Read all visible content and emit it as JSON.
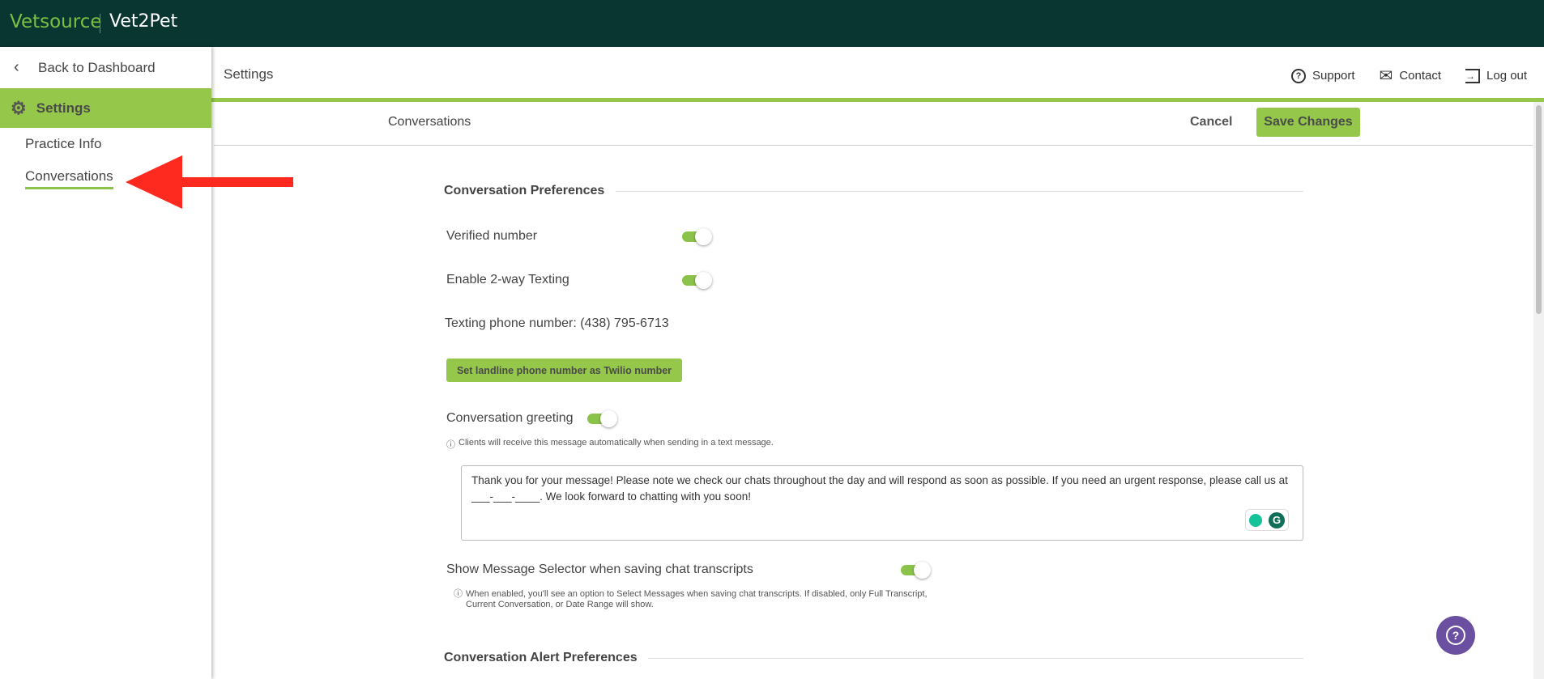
{
  "header": {
    "brand": "Vetsource",
    "app": "Vet2Pet"
  },
  "sidebar": {
    "back": "Back to Dashboard",
    "section": "Settings",
    "items": [
      {
        "label": "Practice Info"
      },
      {
        "label": "Conversations"
      }
    ]
  },
  "topbar": {
    "title": "Settings",
    "links": [
      {
        "label": "Support",
        "icon": "help-circle-icon"
      },
      {
        "label": "Contact",
        "icon": "mail-icon"
      },
      {
        "label": "Log out",
        "icon": "logout-icon"
      }
    ]
  },
  "subbar": {
    "title": "Conversations",
    "cancel": "Cancel",
    "save": "Save Changes"
  },
  "prefs": {
    "section_title": "Conversation Preferences",
    "verified_number": {
      "label": "Verified number",
      "on": true
    },
    "two_way": {
      "label": "Enable 2-way Texting",
      "on": true
    },
    "phone": "Texting phone number: (438) 795-6713",
    "landline_button": "Set landline phone number as Twilio number",
    "greeting": {
      "label": "Conversation greeting",
      "on": true,
      "info": "Clients will receive this message automatically when sending in a text message.",
      "text": "Thank you for your message! Please note we check our chats throughout the day and will respond as soon as possible. If you need an urgent response, please call us at ___-___-____. We look forward to chatting with you soon!"
    },
    "selector": {
      "label": "Show Message Selector when saving chat transcripts",
      "on": true,
      "info": "When enabled, you'll see an option to Select Messages when saving chat transcripts. If disabled, only Full Transcript, Current Conversation, or Date Range will show."
    },
    "alert_title": "Conversation Alert Preferences"
  },
  "colors": {
    "header": "#0a3632",
    "accent": "#95c84a",
    "fab": "#6b4fa0",
    "arrow": "#ff2a1f"
  }
}
